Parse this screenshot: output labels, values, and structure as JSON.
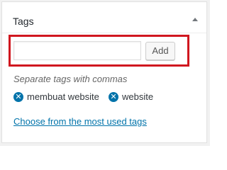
{
  "panel": {
    "title": "Tags",
    "toggle_icon": "triangle-up-icon"
  },
  "tag_input": {
    "value": "",
    "placeholder": ""
  },
  "add_button": {
    "label": "Add"
  },
  "howto": "Separate tags with commas",
  "tags": [
    {
      "label": "membuat website",
      "remove_icon": "circle-x-icon"
    },
    {
      "label": "website",
      "remove_icon": "circle-x-icon"
    }
  ],
  "most_used_link": "Choose from the most used tags",
  "colors": {
    "highlight": "#d0171f",
    "link": "#0073aa"
  }
}
